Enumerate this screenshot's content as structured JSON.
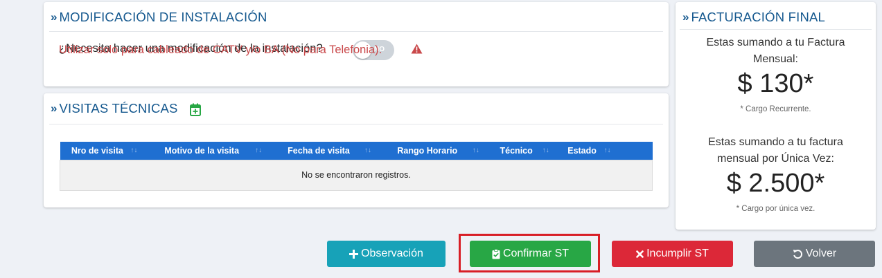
{
  "modification": {
    "title": "MODIFICACIÓN DE INSTALACIÓN",
    "question": "¿Necesita hacer una modificación de la instalación?",
    "toggle_label": "NO",
    "warning": "Utilizar solo para cableado de CATV y/o BA (No para Telefonia)."
  },
  "visits": {
    "title": "VISITAS TÉCNICAS",
    "columns": [
      "Nro de visita",
      "Motivo de la visita",
      "Fecha de visita",
      "Rango Horario",
      "Técnico",
      "Estado"
    ],
    "empty_message": "No se encontraron registros."
  },
  "billing": {
    "title": "FACTURACIÓN FINAL",
    "monthly_text": "Estas sumando a tu Factura Mensual:",
    "monthly_amount": "$ 130*",
    "monthly_note": "* Cargo Recurrente.",
    "once_text": "Estas sumando a tu factura mensual por Única Vez:",
    "once_amount": "$ 2.500*",
    "once_note": "* Cargo por única vez."
  },
  "buttons": {
    "observacion": "Observación",
    "confirmar": "Confirmar ST",
    "incumplir": "Incumplir ST",
    "volver": "Volver"
  },
  "colors": {
    "title_blue": "#16598f",
    "table_header": "#1f6fd1",
    "warning_red": "#c9484a",
    "btn_info": "#17a2b8",
    "btn_success": "#28a745",
    "btn_danger": "#dc2838",
    "btn_secondary": "#6c757d",
    "highlight": "#d81e26"
  }
}
